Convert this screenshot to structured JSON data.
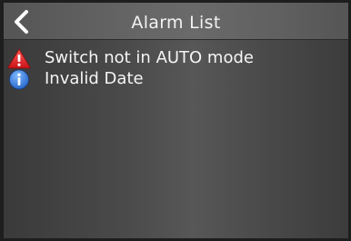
{
  "header": {
    "title": "Alarm List",
    "back_icon": "chevron-left-icon"
  },
  "alarms": [
    {
      "text": "Switch not in AUTO mode",
      "icon": "warning-triangle-icon",
      "color": "#e0262a"
    },
    {
      "text": "Invalid Date",
      "icon": "info-circle-icon",
      "color": "#2f7fe0"
    }
  ],
  "colors": {
    "header_bg": "#666666",
    "screen_bg": "#4a4a4a",
    "text": "#f5f5f5"
  }
}
